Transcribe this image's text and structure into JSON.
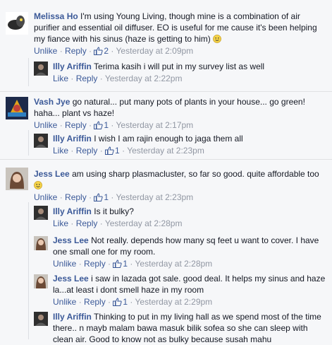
{
  "labels": {
    "unlike": "Unlike",
    "like": "Like",
    "reply": "Reply",
    "sep": " · "
  },
  "comments": [
    {
      "name": "Melissa Ho",
      "text": "I'm using Young Living, though mine is a combination of air purifier and essential oil diffuser. EO is useful for me cause it's been helping my fiance with his sinus (haze is getting to him)",
      "likes": "2",
      "time": "Yesterday at 2:09pm"
    },
    {
      "name": "Illy Ariffin",
      "text": "Terima kasih i will put in my survey list as well",
      "time": "Yesterday at 2:22pm"
    },
    {
      "name": "Vash Jye",
      "text": "go natural... put many pots of plants in your house... go green! haha... plant vs haze!",
      "likes": "1",
      "time": "Yesterday at 2:17pm"
    },
    {
      "name": "Illy Ariffin",
      "text": "I wish I am rajin enough to jaga them all",
      "likes": "1",
      "time": "Yesterday at 2:23pm"
    },
    {
      "name": "Jess Lee",
      "text": "am using sharp plasmacluster, so far so good. quite affordable too",
      "likes": "1",
      "time": "Yesterday at 2:23pm"
    },
    {
      "name": "Illy Ariffin",
      "text": "Is it bulky?",
      "time": "Yesterday at 2:28pm"
    },
    {
      "name": "Jess Lee",
      "text": "Not really. depends how many sq feet u want to cover. I have one small one for my room.",
      "likes": "1",
      "time": "Yesterday at 2:28pm"
    },
    {
      "name": "Jess Lee",
      "text": "i saw in lazada got sale. good deal. It helps my sinus and haze la...at least i dont smell haze in my room",
      "likes": "1",
      "time": "Yesterday at 2:29pm"
    },
    {
      "name": "Illy Ariffin",
      "text": "Thinking to put in my living hall as we spend most of the time there.. n mayb malam bawa masuk bilik sofea so she can sleep with clean air. Good to know not as bulky because susah mahu"
    }
  ],
  "colors": {
    "link": "#3b5998",
    "meta": "#9197a3",
    "bg": "#f6f7f9"
  }
}
